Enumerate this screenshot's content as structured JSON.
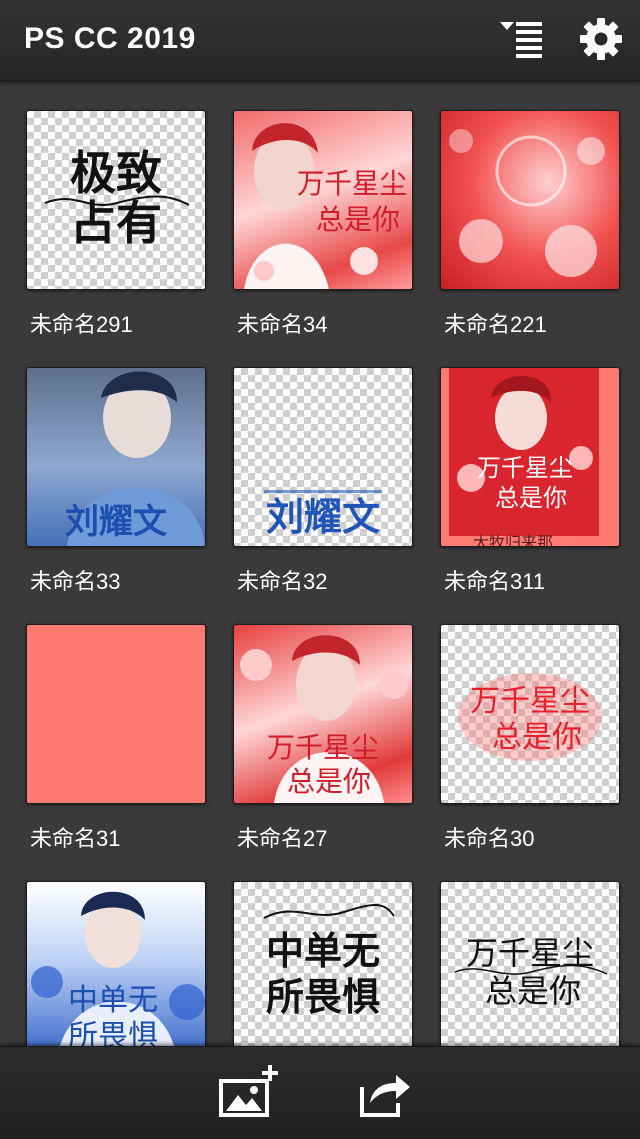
{
  "app": {
    "title": "PS CC 2019"
  },
  "toolbar": {
    "sort_icon": "sort-list-icon",
    "settings_icon": "gear-icon"
  },
  "thumbnail_text": {
    "poster_name": "刘耀文",
    "lyric_a": "万千星尘",
    "lyric_b": "总是你",
    "lyric_c": "中单无",
    "lyric_d": "所畏惧",
    "lyric_e": "极致",
    "lyric_f": "占有",
    "lyric_g": "大牧归来那"
  },
  "projects": [
    {
      "name": "未命名291",
      "thumb": "calligraphy-black-transparent"
    },
    {
      "name": "未命名34",
      "thumb": "red-portrait-poster"
    },
    {
      "name": "未命名221",
      "thumb": "red-floral-background"
    },
    {
      "name": "未命名33",
      "thumb": "blue-portrait-poster"
    },
    {
      "name": "未命名32",
      "thumb": "blue-text-transparent"
    },
    {
      "name": "未命名311",
      "thumb": "red-portrait-poster-coral"
    },
    {
      "name": "未命名31",
      "thumb": "solid-coral"
    },
    {
      "name": "未命名27",
      "thumb": "red-portrait-poster"
    },
    {
      "name": "未命名30",
      "thumb": "red-glow-text-transparent"
    },
    {
      "name": "",
      "thumb": "blue-portrait-poster"
    },
    {
      "name": "",
      "thumb": "calligraphy-black-transparent"
    },
    {
      "name": "",
      "thumb": "calligraphy-black-transparent"
    }
  ],
  "bottom_bar": {
    "add_icon": "add-image-icon",
    "share_icon": "share-icon"
  },
  "colors": {
    "bar": "#262626",
    "background": "#3a3a3a",
    "coral": "#ff7b72",
    "red": "#e23a3a",
    "blue": "#2f5fb8"
  }
}
